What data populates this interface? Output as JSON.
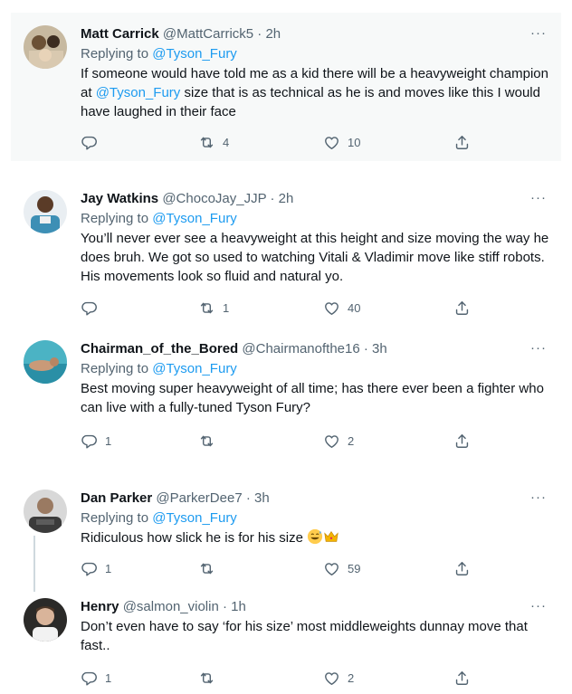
{
  "tweets": [
    {
      "name": "Matt Carrick",
      "handle": "@MattCarrick5",
      "time": "· 2h",
      "reply_prefix": "Replying to",
      "reply_to": "@Tyson_Fury",
      "body_a": "If someone would have told me as a kid there will be a heavyweight champion at ",
      "body_mention": "@Tyson_Fury",
      "body_b": " size that is as technical as he is and moves like this I would have laughed in their face",
      "replies": "",
      "retweets": "4",
      "likes": "10",
      "more": "···"
    },
    {
      "name": "Jay Watkins",
      "handle": "@ChocoJay_JJP",
      "time": "· 2h",
      "reply_prefix": "Replying to",
      "reply_to": "@Tyson_Fury",
      "body": "You’ll never ever see a heavyweight at this height and size moving the way he does bruh. We got so used to watching Vitali & Vladimir move like stiff robots. His movements look so fluid and natural yo.",
      "replies": "",
      "retweets": "1",
      "likes": "40",
      "more": "···"
    },
    {
      "name": "Chairman_of_the_Bored",
      "handle": "@Chairmanofthe16",
      "time": "· 3h",
      "reply_prefix": "Replying to",
      "reply_to": "@Tyson_Fury",
      "body": "Best moving super heavyweight of all time; has there ever been a fighter who can live with a fully-tuned Tyson Fury?",
      "replies": "1",
      "retweets": "",
      "likes": "2",
      "more": "···"
    },
    {
      "name": "Dan Parker",
      "handle": "@ParkerDee7",
      "time": "· 3h",
      "reply_prefix": "Replying to",
      "reply_to": "@Tyson_Fury",
      "body": "Ridiculous how slick he is for his size",
      "emojis": [
        "grinning-sweat-emoji",
        "crown-emoji"
      ],
      "replies": "1",
      "retweets": "",
      "likes": "59",
      "more": "···"
    },
    {
      "name": "Henry",
      "handle": "@salmon_violin",
      "time": "· 1h",
      "body": "Don’t even have to say ‘for his size’ most middleweights dunnay move that fast..",
      "replies": "1",
      "retweets": "",
      "likes": "2",
      "more": "···"
    }
  ],
  "icons": [
    "reply-icon",
    "retweet-icon",
    "like-icon",
    "share-icon"
  ],
  "colors": {
    "accent": "#1d9bf0",
    "muted": "#536471",
    "text": "#0f1419",
    "highlight_bg": "#f7f9f9"
  }
}
